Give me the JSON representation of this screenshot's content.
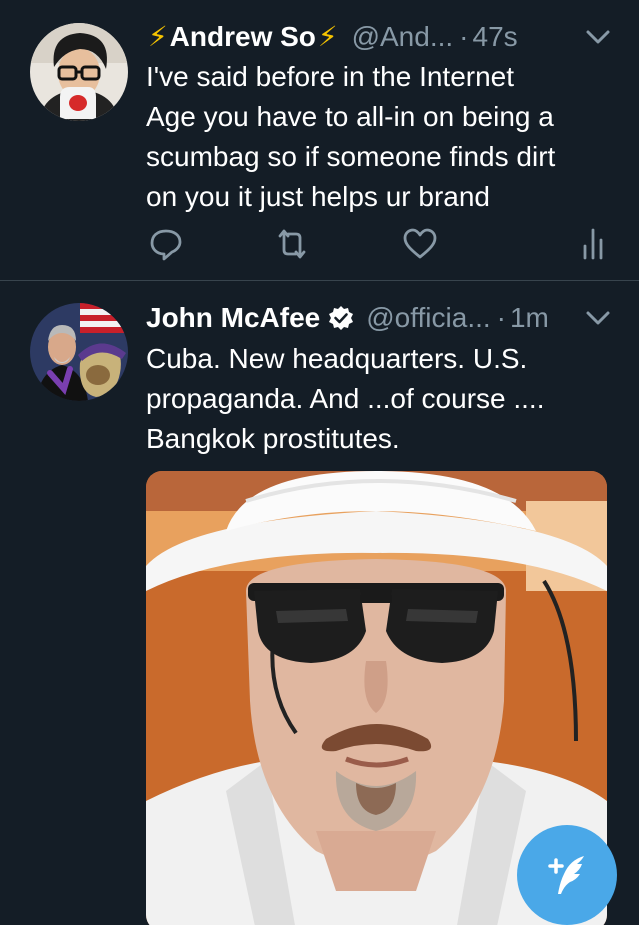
{
  "colors": {
    "background": "#141d26",
    "divider": "#38444d",
    "secondary_text": "#8899a6",
    "accent": "#4aa8e8",
    "bolt": "#f5c300"
  },
  "tweets": [
    {
      "name": "Andrew So",
      "name_prefix_icon": "lightning-bolt-icon",
      "name_suffix_icon": "lightning-bolt-icon",
      "handle": "@And...",
      "separator": "·",
      "time": "47s",
      "lines": [
        "I've said before in the Internet",
        "Age you have to all-in on being a",
        "scumbag so if someone finds dirt",
        "on you it just helps ur brand"
      ],
      "actions": [
        "reply-icon",
        "retweet-icon",
        "like-icon",
        "analytics-icon"
      ]
    },
    {
      "name": "John McAfee",
      "verified_icon": "verified-badge-icon",
      "handle": "@officia...",
      "separator": "·",
      "time": "1m",
      "lines": [
        "Cuba. New headquarters. U.S.",
        "propaganda. And ...of course ....",
        "Bangkok prostitutes."
      ],
      "media_icon": "photo-man-in-white-hat-sunglasses"
    }
  ],
  "fab": {
    "icon": "compose-tweet-icon"
  }
}
